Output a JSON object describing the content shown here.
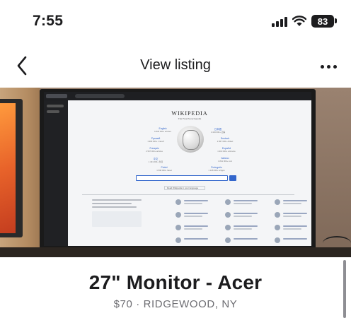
{
  "status_bar": {
    "time": "7:55",
    "battery": "83",
    "icons": [
      "signal-icon",
      "wifi-icon",
      "battery-icon"
    ]
  },
  "nav": {
    "back_icon": "chevron-left-icon",
    "title": "View listing",
    "more_icon": "more-horizontal-icon"
  },
  "photo": {
    "screen_content": {
      "wordmark": "WIKIPEDIA",
      "tagline": "The Free Encyclopedia",
      "languages": [
        {
          "name": "English",
          "count": "6 835 000+ articles"
        },
        {
          "name": "日本語",
          "count": "1 416 000+ 記事"
        },
        {
          "name": "Русский",
          "count": "1 983 000+ статей"
        },
        {
          "name": "Deutsch",
          "count": "2 867 000+ Artikel"
        },
        {
          "name": "Français",
          "count": "2 597 000+ articles"
        },
        {
          "name": "Español",
          "count": "1 919 000+ artículos"
        },
        {
          "name": "中文",
          "count": "1 401 000+ 条目"
        },
        {
          "name": "Italiano",
          "count": "1 841 000+ voci"
        },
        {
          "name": "Polski",
          "count": "1 598 000+ haseł"
        },
        {
          "name": "Português",
          "count": "1 128 000+ artigos"
        }
      ],
      "read_button": "Read Wikipedia in your language"
    }
  },
  "listing": {
    "title": "27\" Monitor - Acer",
    "meta": "$70 · RIDGEWOOD, NY"
  },
  "colors": {
    "text_primary": "#1c1c1e",
    "text_secondary": "#6d6d72",
    "wiki_link": "#3366cc"
  }
}
